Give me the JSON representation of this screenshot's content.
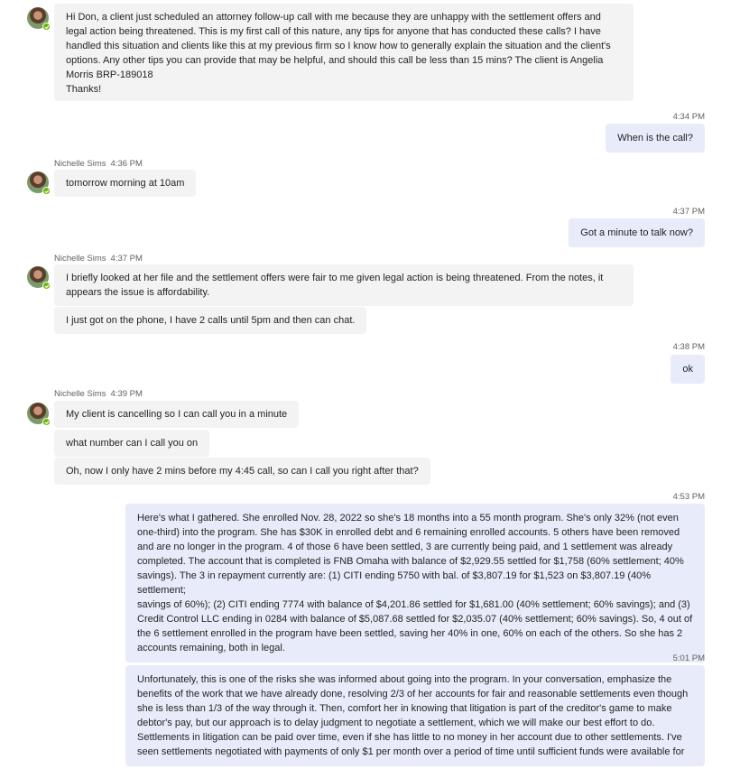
{
  "conversation": {
    "first_message": {
      "text": "Hi Don, a client just scheduled an attorney follow-up call with me because they are unhappy with the settlement offers and\nlegal action being threatened. This is my first call of this nature, any tips for anyone that has conducted these calls? I have\nhandled this situation and clients like this at my previous firm so I know how to generally explain the situation and the client's\noptions. Any other tips you can provide that may be helpful, and should this call be less than 15 mins? The client is Angelia\nMorris BRP-189018\nThanks!"
    },
    "out1": {
      "time": "4:34 PM",
      "text": "When is the call?"
    },
    "in1": {
      "sender": "Nichelle Sims",
      "time": "4:36 PM",
      "text": "tomorrow morning at 10am"
    },
    "out2": {
      "time": "4:37 PM",
      "text": "Got a minute to talk now?"
    },
    "in2": {
      "sender": "Nichelle Sims",
      "time": "4:37 PM",
      "text1": "I briefly looked at her file and the settlement offers were fair to me given legal action is being threatened. From the notes, it\nappears the issue is affordability.",
      "text2": "I just got on the phone, I have 2 calls until 5pm and then can chat."
    },
    "out3": {
      "time": "4:38 PM",
      "text": "ok"
    },
    "in3": {
      "sender": "Nichelle Sims",
      "time": "4:39 PM",
      "text1": "My client is cancelling so I can call you in a minute",
      "text2": "what number can I call you on",
      "text3": "Oh, now I only have 2 mins before my 4:45 call, so can I call you right after that?"
    },
    "out4": {
      "time": "4:53 PM",
      "text": "Here's what I gathered. She enrolled Nov. 28, 2022 so she's 18 months into a 55 month program. She's only 32% (not even\none-third) into the program. She has $30K in enrolled debt and 6 remaining enrolled accounts. 5 others have been removed\nand are no longer in the program. 4 of those 6 have been settled, 3 are currently being paid, and 1 settlement was already\ncompleted.  The account that is completed is FNB Omaha with balance of $2,929.55 settled for $1,758 (60% settlement; 40%\nsavings). The 3 in repayment currently are: (1) CITI ending 5750 with bal. of $3,807.19 for $1,523 on $3,807.19 (40% settlement;\nsavings of 60%); (2) CITI ending 7774 with balance of $4,201.86 settled for $1,681.00 (40% settlement; 60% savings); and (3)\nCredit Control LLC ending in 0284 with balance of $5,087.68 settled for $2,035.07 (40% settlement; 60% savings).  So, 4 out of\nthe 6 settlement enrolled in the program have been settled, saving her 40% in one, 60% on each of the others. So she has 2\naccounts remaining, both in legal."
    },
    "out5": {
      "time": "5:01 PM",
      "text": "Unfortunately, this is one of the risks she was informed about going into the program. In your conversation, emphasize the\nbenefits of the work that we have already done, resolving 2/3 of her accounts for fair and reasonable settlements even though\nshe is less than 1/3 of the way through it. Then, comfort her in knowing that litigation is part of the creditor's game to make\ndebtor's pay, but our approach is to delay judgment to negotiate a settlement, which we will make our best effort to do.\nSettlements in litigation can be paid over time, even if she has little to no money in her account due to other settlements. I've\nseen settlements negotiated with payments of only $1 per month over a period of time until sufficient funds were available for"
    }
  }
}
